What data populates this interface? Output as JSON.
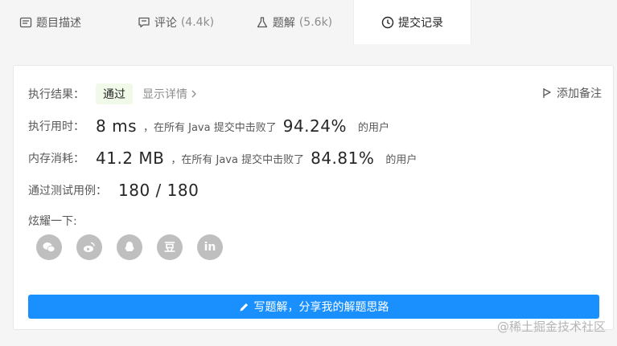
{
  "tabs": [
    {
      "label": "题目描述",
      "count": "",
      "icon": "description-icon"
    },
    {
      "label": "评论",
      "count": "(4.4k)",
      "icon": "comment-icon"
    },
    {
      "label": "题解",
      "count": "(5.6k)",
      "icon": "flask-icon"
    },
    {
      "label": "提交记录",
      "count": "",
      "icon": "clock-icon"
    }
  ],
  "result": {
    "label": "执行结果：",
    "status": "通过",
    "detail": "显示详情",
    "add_note": "添加备注"
  },
  "runtime": {
    "label": "执行用时：",
    "value": "8 ms",
    "mid": "，在所有 Java 提交中击败了",
    "percent": "94.24%",
    "suffix": "的用户"
  },
  "memory": {
    "label": "内存消耗：",
    "value": "41.2 MB",
    "mid": "，在所有 Java 提交中击败了",
    "percent": "84.81%",
    "suffix": "的用户"
  },
  "tests": {
    "label": "通过测试用例：",
    "value": "180 / 180"
  },
  "share": {
    "label": "炫耀一下:",
    "icons": [
      "wechat-icon",
      "weibo-icon",
      "qq-icon",
      "douban-icon",
      "linkedin-icon"
    ],
    "douban_glyph": "豆",
    "linkedin_glyph": "in"
  },
  "write_button": "写题解，分享我的解题思路",
  "watermark": "@稀土掘金技术社区",
  "colors": {
    "accent": "#1a90ff",
    "success_bg": "#f1f9e9"
  }
}
